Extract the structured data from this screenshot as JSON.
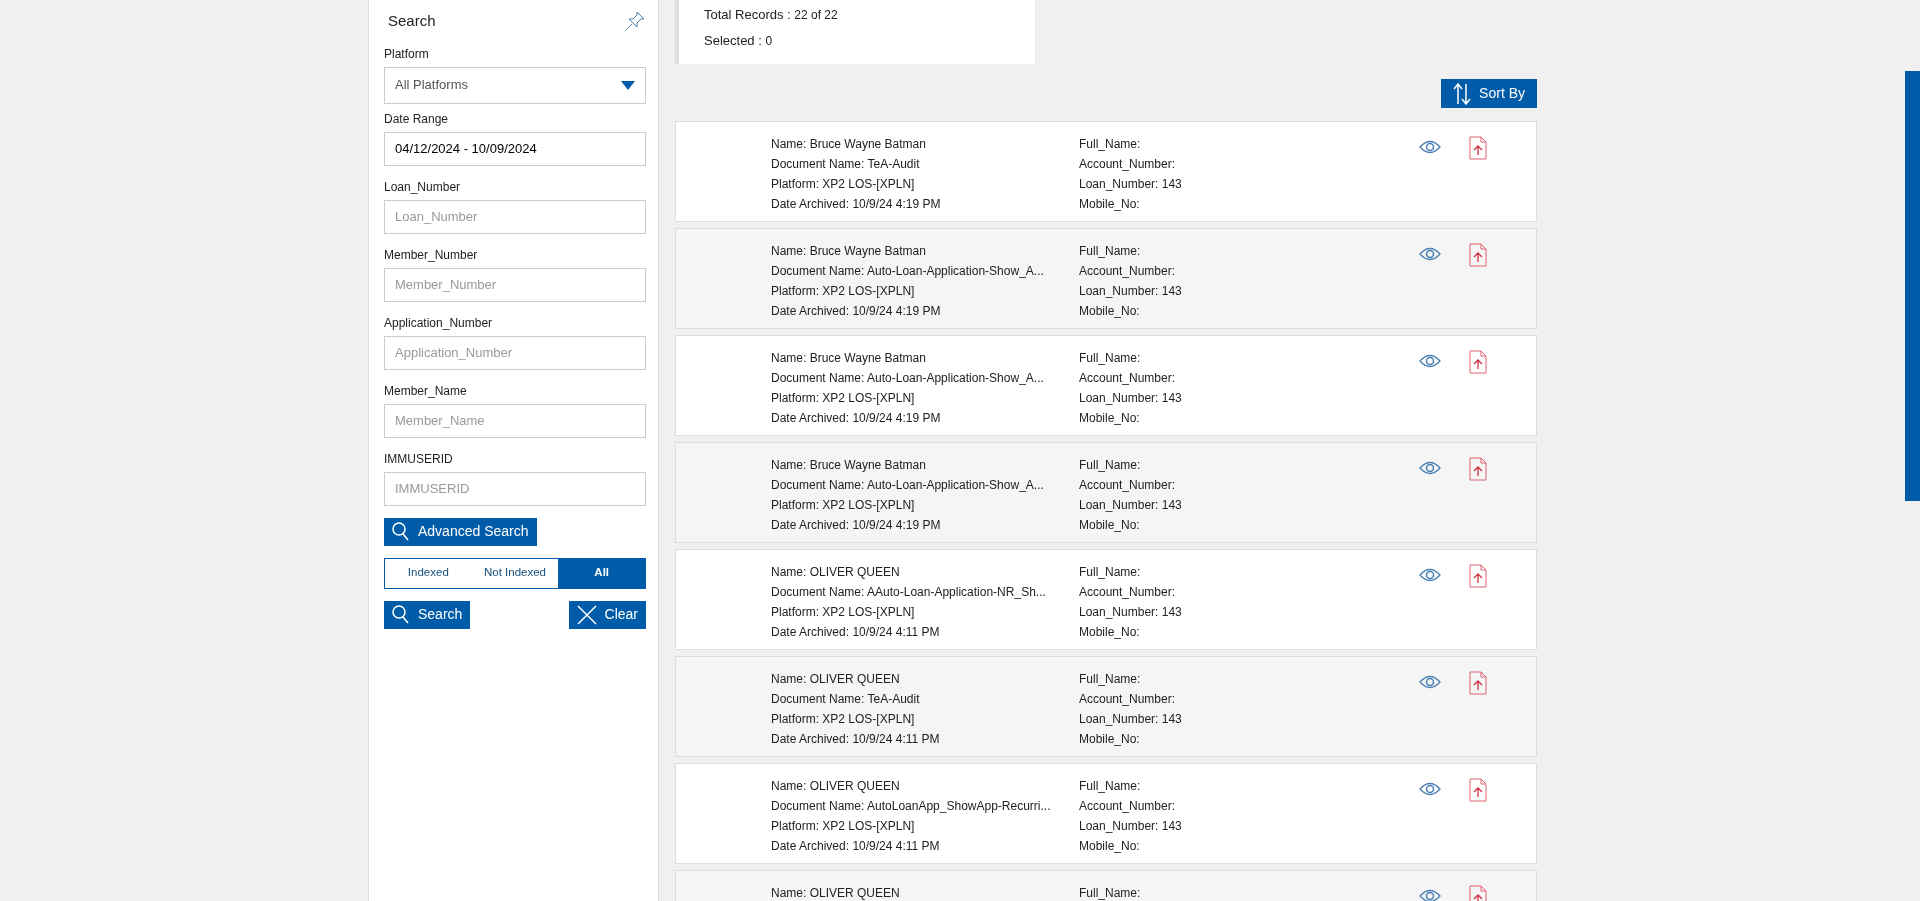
{
  "search_panel": {
    "title": "Search",
    "platform": {
      "label": "Platform",
      "value": "All Platforms"
    },
    "date_range": {
      "label": "Date Range",
      "value": "04/12/2024 - 10/09/2024"
    },
    "fields": [
      {
        "label": "Loan_Number",
        "placeholder": "Loan_Number"
      },
      {
        "label": "Member_Number",
        "placeholder": "Member_Number"
      },
      {
        "label": "Application_Number",
        "placeholder": "Application_Number"
      },
      {
        "label": "Member_Name",
        "placeholder": "Member_Name"
      },
      {
        "label": "IMMUSERID",
        "placeholder": "IMMUSERID"
      }
    ],
    "advanced_search": "Advanced Search",
    "filter": [
      {
        "label": "Indexed",
        "selected": false
      },
      {
        "label": "Not Indexed",
        "selected": false
      },
      {
        "label": "All",
        "selected": true
      }
    ],
    "search_button": "Search",
    "clear_button": "Clear"
  },
  "summary": {
    "total_label": "Total Records :",
    "total_value": "22 of 22",
    "selected_label": "Selected :",
    "selected_value": "0"
  },
  "sort_button": "Sort By",
  "records": [
    {
      "left": [
        "Name: Bruce Wayne Batman",
        "Document Name: TeA-Audit",
        "Platform: XP2 LOS-[XPLN]",
        "Date Archived: 10/9/24 4:19 PM"
      ],
      "right": [
        "Full_Name:",
        "Account_Number:",
        "Loan_Number: 143",
        "Mobile_No:"
      ]
    },
    {
      "left": [
        "Name: Bruce Wayne Batman",
        "Document Name: Auto-Loan-Application-Show_A...",
        "Platform: XP2 LOS-[XPLN]",
        "Date Archived: 10/9/24 4:19 PM"
      ],
      "right": [
        "Full_Name:",
        "Account_Number:",
        "Loan_Number: 143",
        "Mobile_No:"
      ]
    },
    {
      "left": [
        "Name: Bruce Wayne Batman",
        "Document Name: Auto-Loan-Application-Show_A...",
        "Platform: XP2 LOS-[XPLN]",
        "Date Archived: 10/9/24 4:19 PM"
      ],
      "right": [
        "Full_Name:",
        "Account_Number:",
        "Loan_Number: 143",
        "Mobile_No:"
      ]
    },
    {
      "left": [
        "Name: Bruce Wayne Batman",
        "Document Name: Auto-Loan-Application-Show_A...",
        "Platform: XP2 LOS-[XPLN]",
        "Date Archived: 10/9/24 4:19 PM"
      ],
      "right": [
        "Full_Name:",
        "Account_Number:",
        "Loan_Number: 143",
        "Mobile_No:"
      ]
    },
    {
      "left": [
        "Name: OLIVER QUEEN",
        "Document Name: AAuto-Loan-Application-NR_Sh...",
        "Platform: XP2 LOS-[XPLN]",
        "Date Archived: 10/9/24 4:11 PM"
      ],
      "right": [
        "Full_Name:",
        "Account_Number:",
        "Loan_Number: 143",
        "Mobile_No:"
      ]
    },
    {
      "left": [
        "Name: OLIVER QUEEN",
        "Document Name: TeA-Audit",
        "Platform: XP2 LOS-[XPLN]",
        "Date Archived: 10/9/24 4:11 PM"
      ],
      "right": [
        "Full_Name:",
        "Account_Number:",
        "Loan_Number: 143",
        "Mobile_No:"
      ]
    },
    {
      "left": [
        "Name: OLIVER QUEEN",
        "Document Name: AutoLoanApp_ShowApp-Recurri...",
        "Platform: XP2 LOS-[XPLN]",
        "Date Archived: 10/9/24 4:11 PM"
      ],
      "right": [
        "Full_Name:",
        "Account_Number:",
        "Loan_Number: 143",
        "Mobile_No:"
      ]
    },
    {
      "left": [
        "Name: OLIVER QUEEN"
      ],
      "right": [
        "Full_Name:"
      ]
    }
  ]
}
